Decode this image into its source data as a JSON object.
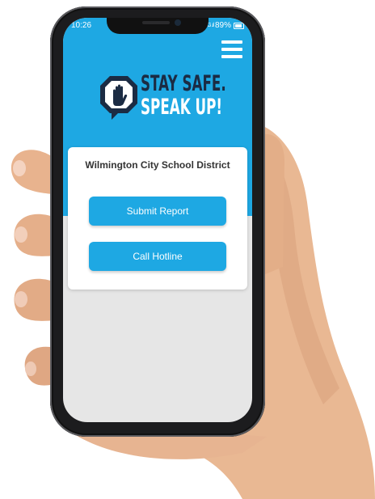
{
  "status_bar": {
    "time": "10:26",
    "signal": "4G .ıl",
    "battery": "89%"
  },
  "header": {
    "menu_icon": "hamburger-menu-icon",
    "logo_icon": "stop-hand-speech-bubble-icon",
    "logo_line1": "STAY SAFE.",
    "logo_line2": "SPEAK UP!"
  },
  "card": {
    "title": "Wilmington City School District",
    "submit_label": "Submit Report",
    "call_label": "Call Hotline"
  },
  "colors": {
    "brand_blue": "#1ea8e3",
    "logo_navy": "#1b2b43",
    "screen_bg": "#e6e6e6"
  }
}
